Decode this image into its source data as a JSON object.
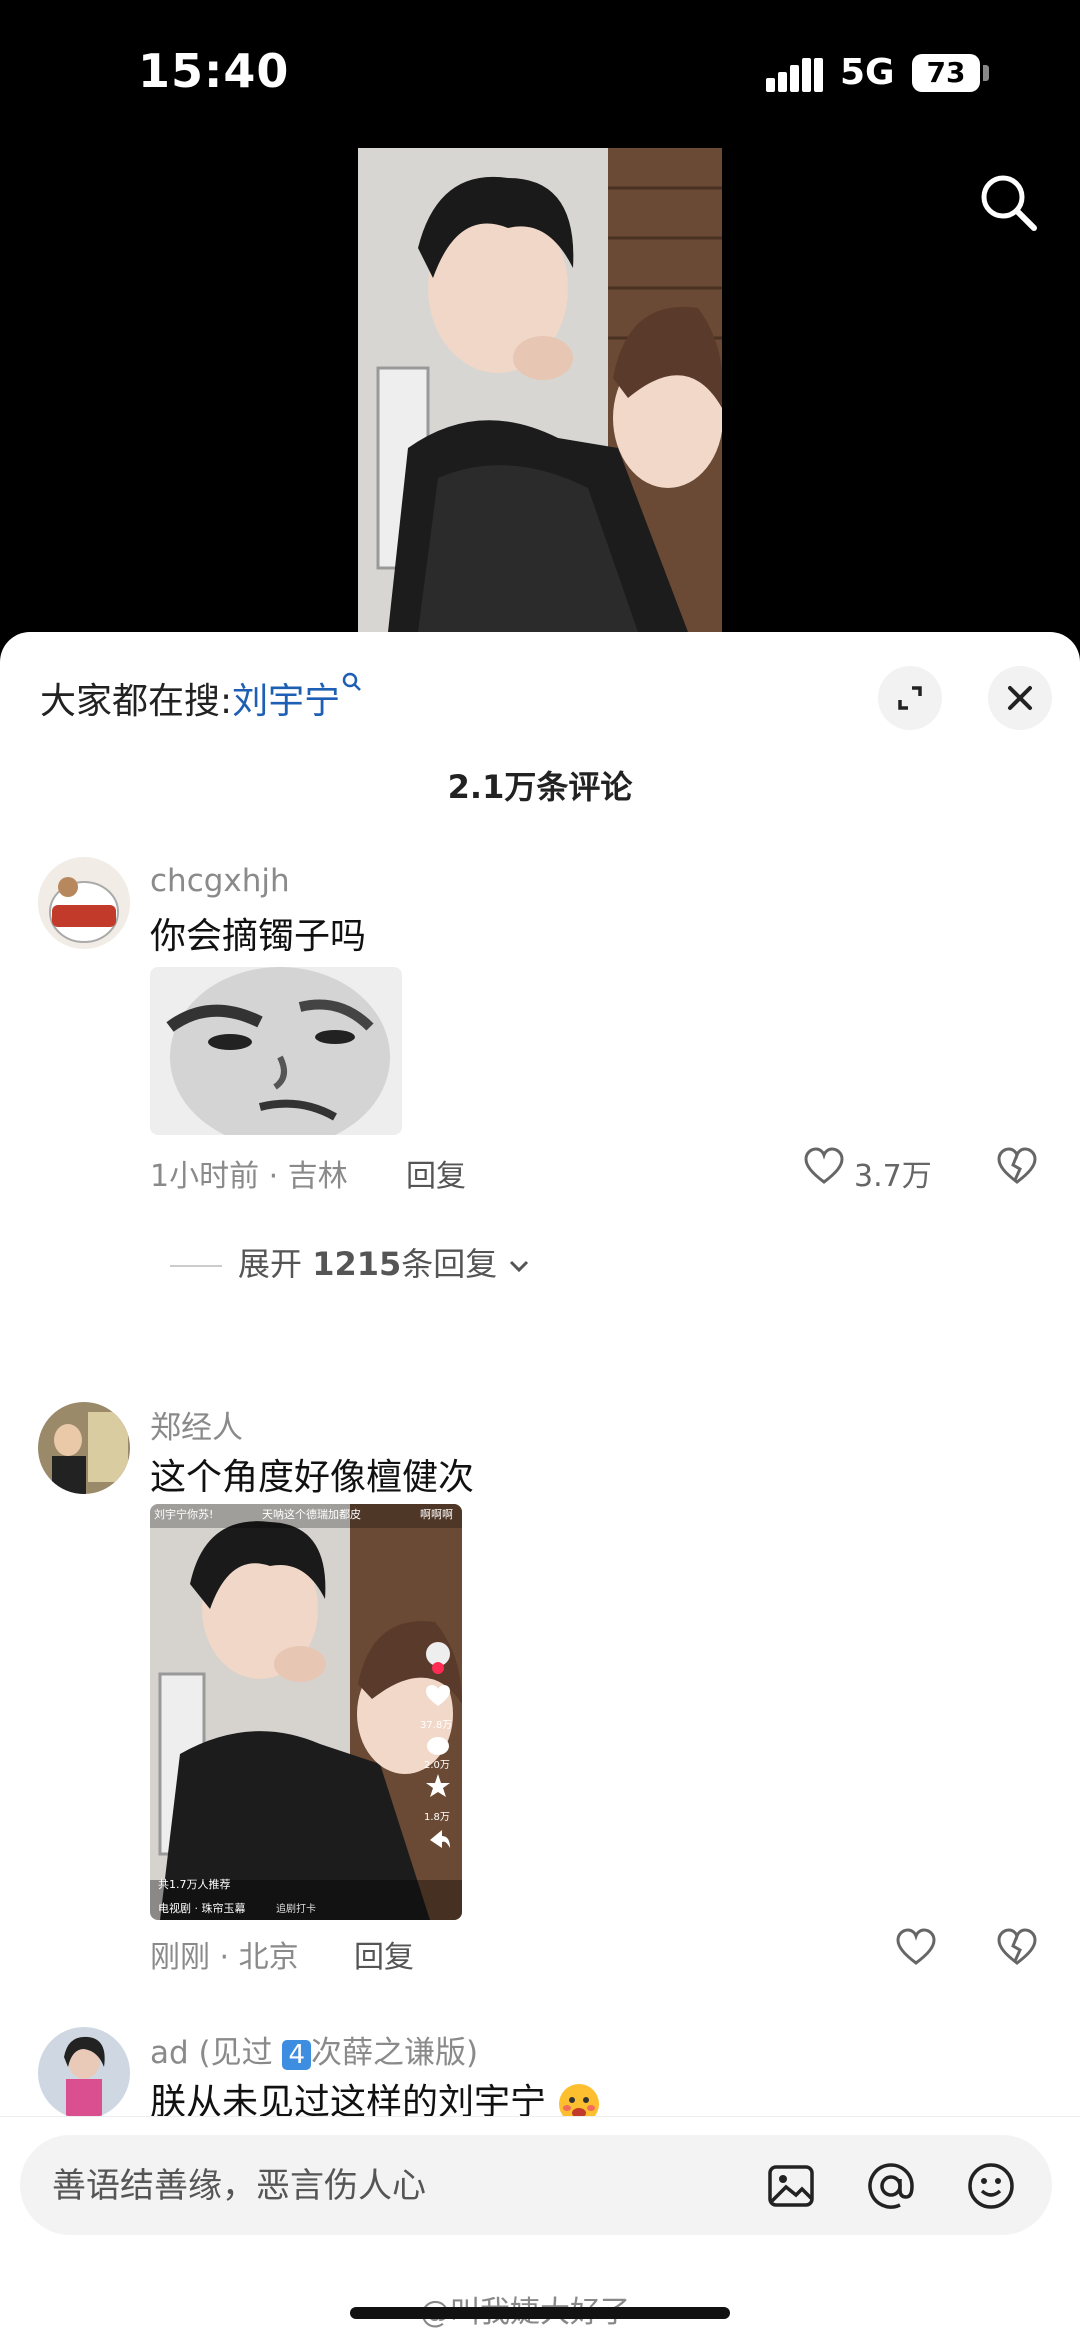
{
  "status_bar": {
    "time": "15:40",
    "network": "5G",
    "battery": "73"
  },
  "sheet": {
    "trending_prefix": "大家都在搜:",
    "trending_keyword": "刘宇宁",
    "comment_count": "2.1万条评论"
  },
  "comments": [
    {
      "username": "chcgxhjh",
      "text": "你会摘镯子吗",
      "meta": "1小时前 · 吉林",
      "reply_label": "回复",
      "likes": "3.7万",
      "expand_replies": "展开",
      "expand_count": "1215",
      "expand_suffix": "条回复"
    },
    {
      "username": "郑经人",
      "text": "这个角度好像檀健次",
      "meta": "刚刚 · 北京",
      "reply_label": "回复",
      "thumb_overlay": {
        "top_left": "刘宇宁你苏!",
        "top_mid": "天呐这个德瑞加都皮",
        "top_right": "啊啊啊",
        "like_count": "37.8万",
        "comment_count": "2.0万",
        "fav_count": "1.8万",
        "recommend": "共1.7万人推荐",
        "show": "电视剧 · 珠帘玉幕",
        "show_tail": "追剧打卡"
      }
    },
    {
      "username": "ad (见过",
      "username_badge": "4",
      "username_suffix": "次薛之谦版)",
      "text": "朕从未见过这样的刘宇宁"
    }
  ],
  "input": {
    "placeholder": "善语结善缘，恶言伤人心"
  },
  "watermark": "@叫我婕大好了",
  "colors": {
    "accent_link": "#1e5fb4",
    "sheet_bg": "#ffffff",
    "top_bg": "#000000"
  }
}
